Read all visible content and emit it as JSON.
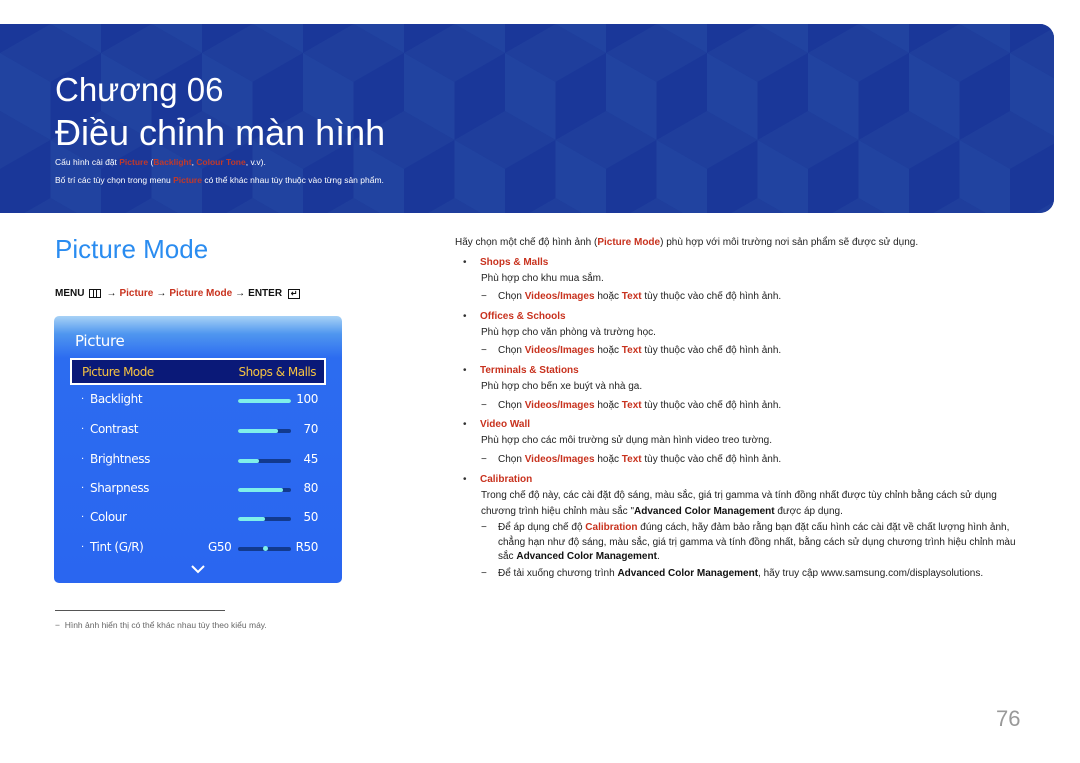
{
  "banner": {
    "chapter": "Chương 06",
    "title": "Điều chỉnh màn hình",
    "line1": {
      "prefix": "Cấu hình cài đặt ",
      "picture": "Picture",
      "open": " (",
      "backlight": "Backlight",
      "comma": ", ",
      "colour_tone": "Colour Tone",
      "suffix": ", v.v)."
    },
    "line2": {
      "prefix": "Bố trí các tùy chọn trong menu ",
      "picture": "Picture",
      "suffix": " có thể khác nhau tùy thuộc vào từng sản phẩm."
    },
    "colors": {
      "background": "#1e3e9c",
      "highlight": "#c0392b"
    }
  },
  "section": {
    "title": "Picture Mode",
    "menu_path": {
      "menu": "MENU",
      "arrow": "→",
      "step1": "Picture",
      "step2": "Picture Mode",
      "enter": "ENTER",
      "menu_icon": "menu-grid-icon",
      "enter_icon": "enter-return-icon"
    }
  },
  "osd": {
    "title": "Picture",
    "selected": {
      "label": "Picture Mode",
      "value": "Shops & Malls"
    },
    "rows": [
      {
        "label": "Backlight",
        "value": "100",
        "level": 1.0
      },
      {
        "label": "Contrast",
        "value": "70",
        "level": 0.75
      },
      {
        "label": "Brightness",
        "value": "45",
        "level": 0.4
      },
      {
        "label": "Sharpness",
        "value": "80",
        "level": 0.85
      },
      {
        "label": "Colour",
        "value": "50",
        "level": 0.5
      }
    ],
    "tint": {
      "label": "Tint (G/R)",
      "left": "G50",
      "right": "R50",
      "position": 0.5
    },
    "bullet": "·",
    "more_icon": "chevron-down-icon"
  },
  "footnote": {
    "dash": "−",
    "text": "Hình ảnh hiển thị có thể khác nhau tùy theo kiểu máy."
  },
  "content": {
    "intro": {
      "prefix": "Hãy chọn một chế độ hình ảnh (",
      "mode": "Picture Mode",
      "suffix": ") phù hợp với môi trường nơi sản phẩm sẽ được sử dụng."
    },
    "bullet": "•",
    "dash": "−",
    "choose": {
      "prefix": "Chọn ",
      "opt1": "Videos/Images",
      "mid": " hoặc ",
      "opt2": "Text",
      "suffix": " tùy thuộc vào chế độ hình ảnh."
    },
    "items": [
      {
        "name": "Shops & Malls",
        "desc": "Phù hợp cho khu mua sắm."
      },
      {
        "name": "Offices & Schools",
        "desc": "Phù hợp cho văn phòng và trường học."
      },
      {
        "name": "Terminals & Stations",
        "desc": "Phù hợp cho bến xe buýt và nhà ga."
      },
      {
        "name": "Video Wall",
        "desc": "Phù hợp cho các môi trường sử dụng màn hình video treo tường."
      }
    ],
    "calibration": {
      "name": "Calibration",
      "para_prefix": "Trong chế độ này, các cài đặt độ sáng, màu sắc, giá trị gamma và tính đồng nhất được tùy chỉnh bằng cách sử dụng chương trình hiệu chỉnh màu sắc \"",
      "para_bold": "Advanced Color Management",
      "para_suffix": " được áp dụng.",
      "note1_prefix": "Để áp dụng chế độ ",
      "note1_red": "Calibration",
      "note1_mid": " đúng cách, hãy đảm bảo rằng bạn đặt cấu hình các cài đặt về chất lượng hình ảnh, chẳng hạn như độ sáng, màu sắc, giá trị gamma và tính đồng nhất, bằng cách sử dụng chương trình hiệu chỉnh màu sắc ",
      "note1_bold": "Advanced Color Management",
      "note1_suffix": ".",
      "note2_prefix": "Để tải xuống chương trình ",
      "note2_bold": "Advanced Color Management",
      "note2_suffix": ", hãy truy cập www.samsung.com/displaysolutions."
    }
  },
  "page_number": "76"
}
